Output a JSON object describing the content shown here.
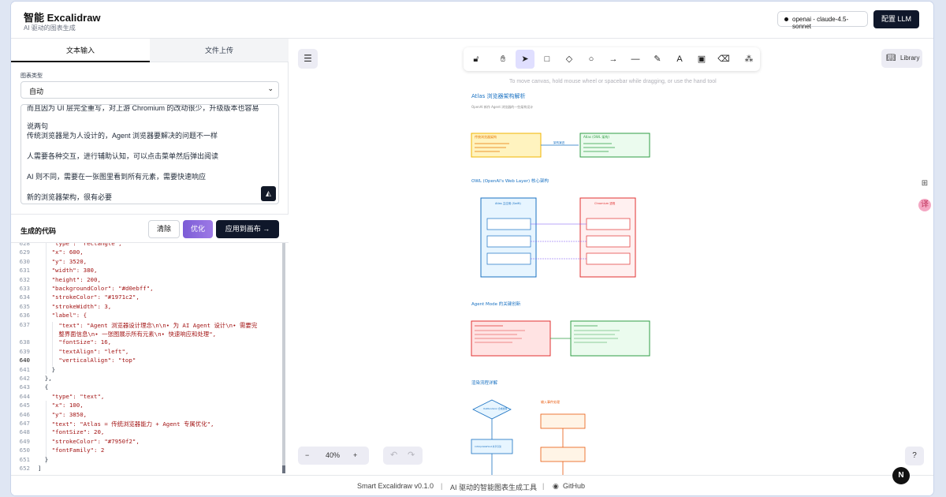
{
  "header": {
    "title": "智能 Excalidraw",
    "subtitle": "AI 驱动的图表生成",
    "model": "openai - claude-4.5-sonnet",
    "config_button": "配置 LLM"
  },
  "left": {
    "tabs": [
      "文本输入",
      "文件上传"
    ],
    "chart_type_label": "图表类型",
    "chart_type_value": "自动",
    "input_lines": [
      "而且因为 UI 层完全重写，对上游 Chromium 的改动很少，升级版本也容易",
      "说两句",
      "传统浏览器是为人设计的，Agent 浏览器要解决的问题不一样",
      "人需要各种交互，进行辅助认知，可以点击菜单然后弹出阅读",
      "AI 则不同，需要在一张图里看到所有元素，需要快速响应",
      "新的浏览器架构，很有必要"
    ],
    "generated_label": "生成的代码",
    "clear_button": "清除",
    "optimize_button": "优化",
    "apply_button": "应用到画布 →"
  },
  "code": {
    "numbers": [
      "628",
      "629",
      "630",
      "631",
      "632",
      "633",
      "634",
      "635",
      "636",
      "637",
      "",
      "638",
      "639",
      "640",
      "641",
      "642",
      "643",
      "644",
      "645",
      "646",
      "647",
      "648",
      "649",
      "650",
      "651",
      "652"
    ],
    "lines": [
      "\"type\": \"rectangle\",",
      "\"x\": 600,",
      "\"y\": 3520,",
      "\"width\": 380,",
      "\"height\": 200,",
      "\"backgroundColor\": \"#d0ebff\",",
      "\"strokeColor\": \"#1971c2\",",
      "\"strokeWidth\": 3,",
      "\"label\": {",
      "\"text\": \"Agent 浏览器设计理念\\n\\n• 为 AI Agent 设计\\n• 需要完",
      "整界面信息\\n• 一张图展示所有元素\\n• 快速响应和处理\",",
      "\"fontSize\": 16,",
      "\"textAlign\": \"left\",",
      "\"verticalAlign\": \"top\"",
      "}",
      "},",
      "{",
      "\"type\": \"text\",",
      "\"x\": 100,",
      "\"y\": 3850,",
      "\"text\": \"Atlas = 传统浏览器能力 + Agent 专属优化\",",
      "\"fontSize\": 20,",
      "\"strokeColor\": \"#7950f2\",",
      "\"fontFamily\": 2",
      "}",
      "]"
    ]
  },
  "canvas": {
    "hint": "To move canvas, hold mouse wheel or spacebar while dragging, or use the hand tool",
    "library": "Library",
    "zoom": "40%",
    "diagram": {
      "title1": "Atlas 浏览器架构解析",
      "sub1": "OpenAI 新作 Agent 浏览器的一些架构设计",
      "box_y1": "传统浏览器架构",
      "box_g1": "Atlas (OWL 架构)",
      "arrow1": "架构演进",
      "title2": "OWL (OpenAI's Web Layer) 核心架构",
      "col_left": "Atlas 主应用 (Swift)",
      "col_right": "Chromium 进程",
      "title3": "Agent Mode 的关键创新",
      "title4": "渲染流程详解",
      "right_label": "输入事件处理",
      "node_a": "OwlRenderer 合成处理",
      "node_b": "InfoUpdateHost 共享渲染"
    }
  },
  "footer": {
    "version": "Smart Excalidraw v0.1.0",
    "tagline": "AI 驱动的智能图表生成工具",
    "github": "GitHub"
  }
}
